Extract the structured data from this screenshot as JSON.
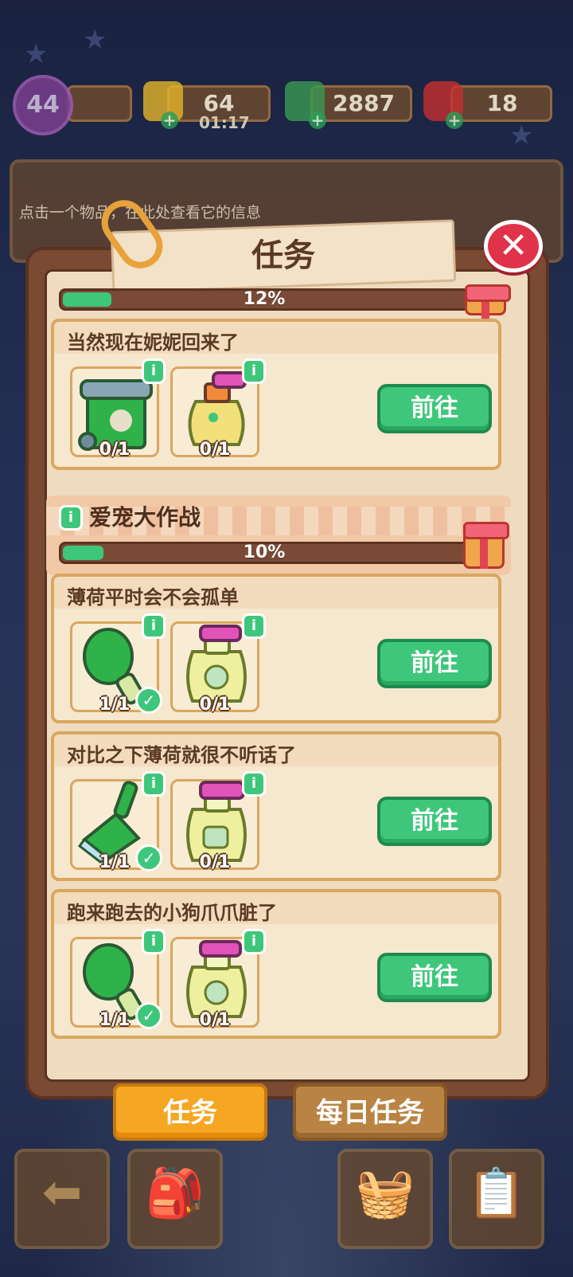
{
  "hud": {
    "level": "44",
    "energy": "64",
    "energy_timer": "01:17",
    "cash": "2887",
    "gems": "18"
  },
  "info_bar": {
    "text": "点击一个物品，在此处查看它的信息"
  },
  "modal": {
    "title": "任务",
    "top_progress_text": "12%",
    "top_progress": 0.12,
    "top_task": {
      "title": "当然现在妮妮回来了",
      "items": [
        {
          "icon": "green-trash-bin-icon",
          "count": "0/1"
        },
        {
          "icon": "cleaning-spray-bottle-icon",
          "count": "0/1"
        }
      ],
      "button": "前往"
    },
    "group": {
      "title": "爱宠大作战",
      "progress_text": "10%",
      "progress": 0.1,
      "tasks": [
        {
          "title": "薄荷平时会不会孤单",
          "items": [
            {
              "icon": "green-brush-icon",
              "count": "1/1",
              "done": true
            },
            {
              "icon": "detergent-bottle-icon",
              "count": "0/1",
              "done": false
            }
          ],
          "button": "前往"
        },
        {
          "title": "对比之下薄荷就很不听话了",
          "items": [
            {
              "icon": "green-broom-icon",
              "count": "1/1",
              "done": true
            },
            {
              "icon": "spray-bottle-icon",
              "count": "0/1",
              "done": false
            }
          ],
          "button": "前往"
        },
        {
          "title": "跑来跑去的小狗爪爪脏了",
          "items": [
            {
              "icon": "green-brush-icon",
              "count": "1/1",
              "done": true
            },
            {
              "icon": "detergent-bottle-icon",
              "count": "0/1",
              "done": false
            }
          ],
          "button": "前往"
        }
      ]
    }
  },
  "tabs": {
    "tasks": "任务",
    "daily_tasks": "每日任务"
  },
  "nav": [
    "back-arrow-icon",
    "backpack-icon",
    "shop-basket-icon",
    "clipboard-star-icon"
  ],
  "colors": {
    "accent_green": "#3ec77a",
    "close_red": "#e0334a",
    "tab_orange": "#f5a623",
    "panel_brown": "#7a4a33"
  }
}
